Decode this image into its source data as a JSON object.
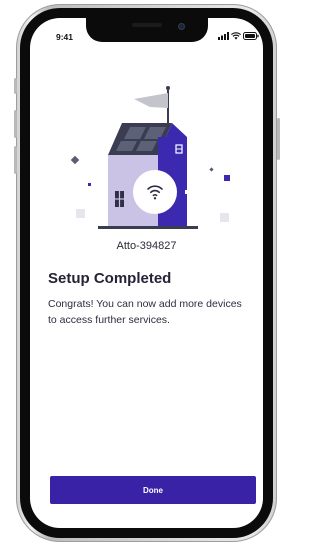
{
  "status_bar": {
    "time": "9:41"
  },
  "device": {
    "name": "Atto-394827"
  },
  "content": {
    "title": "Setup Completed",
    "message": "Congrats! You can now add more devices to access further services."
  },
  "actions": {
    "done_label": "Done"
  },
  "colors": {
    "accent": "#3a22a6",
    "house_light": "#cbc3e6",
    "house_dark": "#3b2ab0",
    "roof": "#3a3d52"
  },
  "icons": {
    "signal": "cellular-signal-icon",
    "wifi": "wifi-icon",
    "battery": "battery-icon",
    "house_wifi": "wifi-icon"
  }
}
